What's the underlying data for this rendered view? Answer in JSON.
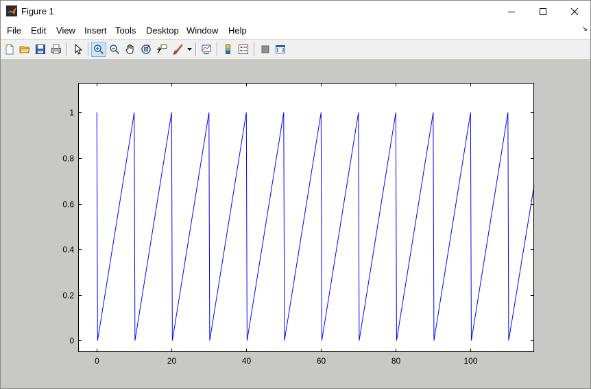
{
  "window": {
    "title": "Figure 1"
  },
  "menu": {
    "items": [
      "File",
      "Edit",
      "View",
      "Insert",
      "Tools",
      "Desktop",
      "Window",
      "Help"
    ]
  },
  "toolbar": {
    "buttons": [
      "new-figure",
      "open-file",
      "save-figure",
      "print-figure",
      "edit-plot",
      "zoom-in",
      "zoom-out",
      "pan",
      "rotate-3d",
      "data-cursor",
      "brush",
      "link-plot",
      "insert-colorbar",
      "insert-legend",
      "hide-plot-tools",
      "show-plot-tools"
    ],
    "active": "zoom-in"
  },
  "chart_data": {
    "type": "line",
    "title": "",
    "xlabel": "",
    "ylabel": "",
    "xlim": [
      -5,
      117
    ],
    "ylim": [
      -0.05,
      1.13
    ],
    "xticks": [
      0,
      20,
      40,
      60,
      80,
      100
    ],
    "yticks": [
      0,
      0.2,
      0.4,
      0.6,
      0.8,
      1
    ],
    "ytick_labels": [
      "0",
      "0.2",
      "0.4",
      "0.6",
      "0.8",
      "1"
    ],
    "grid": false,
    "series": [
      {
        "color": "#0000ff",
        "x": [
          0,
          0.2,
          10,
          10.2,
          20,
          20.2,
          30,
          30.2,
          40,
          40.2,
          50,
          50.2,
          60,
          60.2,
          70,
          70.2,
          80,
          80.2,
          90,
          90.2,
          100,
          100.2,
          110,
          110.2,
          117
        ],
        "y": [
          1,
          0,
          1,
          0,
          1,
          0,
          1,
          0,
          1,
          0,
          1,
          0,
          1,
          0,
          1,
          0,
          1,
          0,
          1,
          0,
          1,
          0,
          1,
          0,
          0.68
        ]
      }
    ]
  }
}
